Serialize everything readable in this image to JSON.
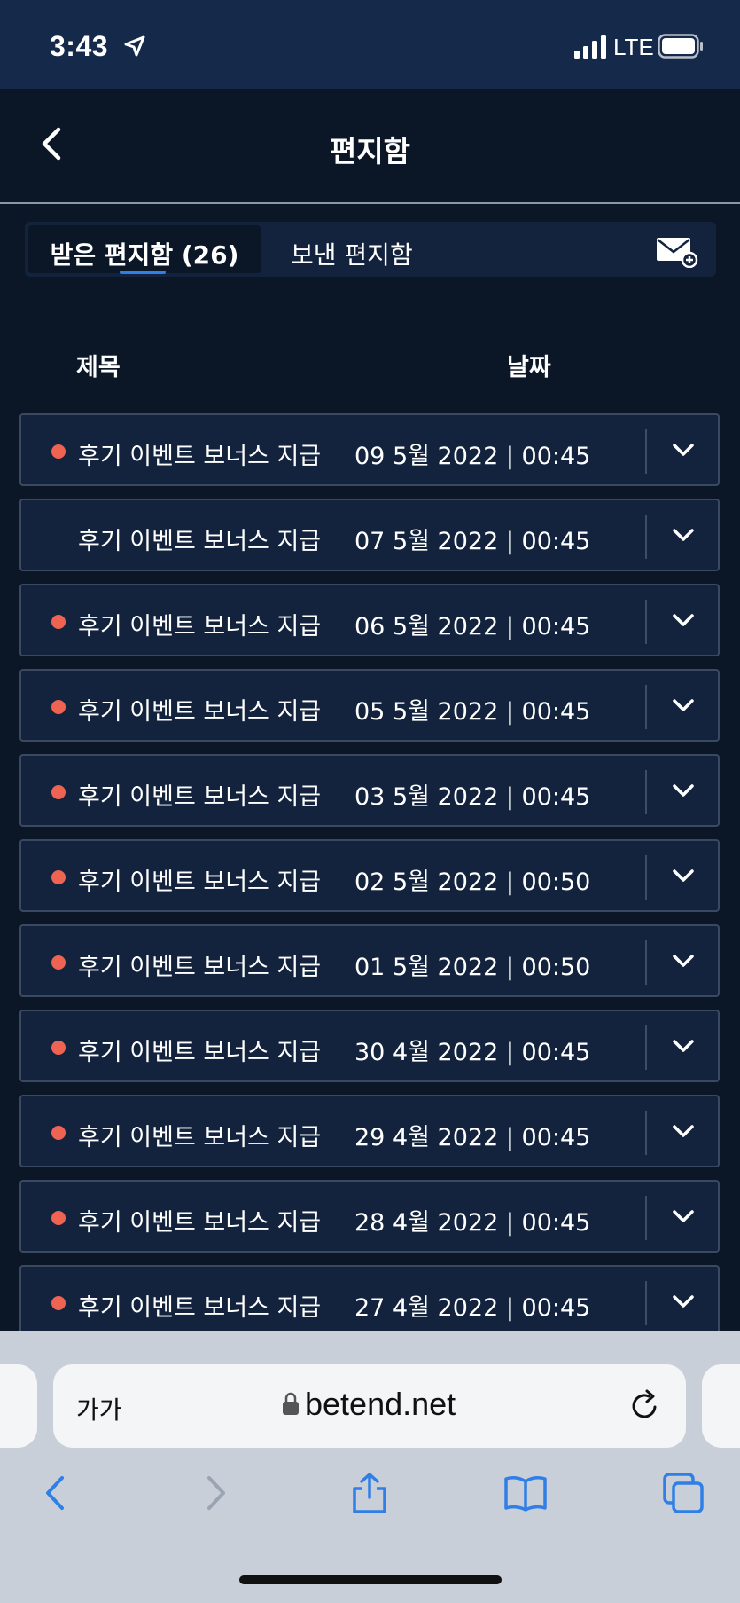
{
  "status_bar": {
    "time": "3:43",
    "network": "LTE"
  },
  "header": {
    "title": "편지함"
  },
  "tabs": {
    "inbox_label": "받은 편지함 (26)",
    "sent_label": "보낸 편지함"
  },
  "columns": {
    "subject": "제목",
    "date": "날짜"
  },
  "messages": [
    {
      "subject": "후기 이벤트 보너스 지급",
      "date": "09 5월 2022 | 00:45",
      "unread": true
    },
    {
      "subject": "후기 이벤트 보너스 지급",
      "date": "07 5월 2022 | 00:45",
      "unread": false
    },
    {
      "subject": "후기 이벤트 보너스 지급",
      "date": "06 5월 2022 | 00:45",
      "unread": true
    },
    {
      "subject": "후기 이벤트 보너스 지급",
      "date": "05 5월 2022 | 00:45",
      "unread": true
    },
    {
      "subject": "후기 이벤트 보너스 지급",
      "date": "03 5월 2022 | 00:45",
      "unread": true
    },
    {
      "subject": "후기 이벤트 보너스 지급",
      "date": "02 5월 2022 | 00:50",
      "unread": true
    },
    {
      "subject": "후기 이벤트 보너스 지급",
      "date": "01 5월 2022 | 00:50",
      "unread": true
    },
    {
      "subject": "후기 이벤트 보너스 지급",
      "date": "30 4월 2022 | 00:45",
      "unread": true
    },
    {
      "subject": "후기 이벤트 보너스 지급",
      "date": "29 4월 2022 | 00:45",
      "unread": true
    },
    {
      "subject": "후기 이벤트 보너스 지급",
      "date": "28 4월 2022 | 00:45",
      "unread": true
    },
    {
      "subject": "후기 이벤트 보너스 지급",
      "date": "27 4월 2022 | 00:45",
      "unread": true
    }
  ],
  "browser": {
    "text_size_label": "가가",
    "url": "betend.net"
  },
  "colors": {
    "unread_dot": "#ef6352",
    "tab_accent": "#2f7fe6",
    "browser_blue": "#2f7fe6"
  },
  "icons": {
    "mail_compose": "mail-plus-icon",
    "expand": "chevron-down-icon"
  }
}
